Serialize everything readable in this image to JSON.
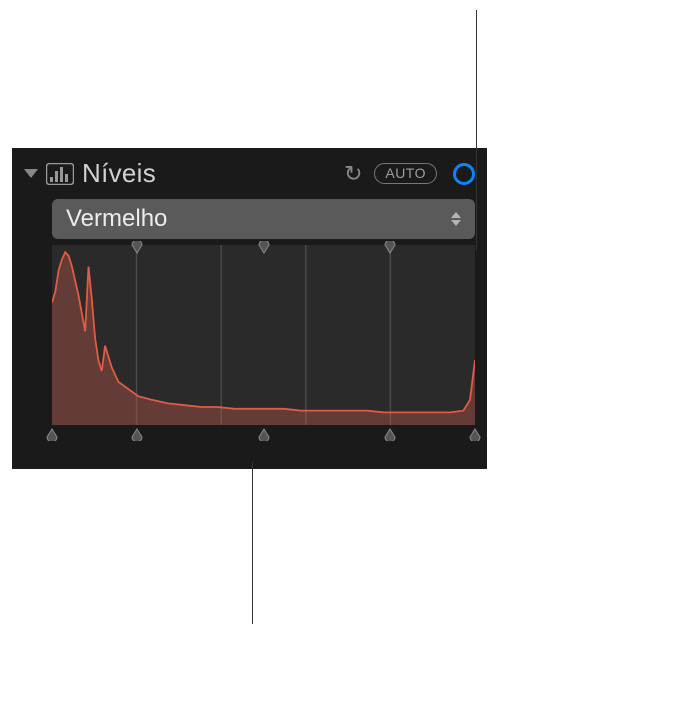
{
  "header": {
    "title": "Níveis",
    "auto_label": "AUTO"
  },
  "channel": {
    "selected": "Vermelho"
  },
  "chart_data": {
    "type": "area",
    "title": "",
    "xlabel": "",
    "ylabel": "",
    "xlim": [
      0,
      255
    ],
    "ylim": [
      0,
      100
    ],
    "grid_x": [
      20,
      40,
      60,
      80
    ],
    "handle_positions_pct": [
      0,
      20,
      50,
      80,
      100
    ],
    "series": [
      {
        "name": "Vermelho",
        "color": "#e25b44",
        "x": [
          0,
          2,
          4,
          6,
          8,
          10,
          12,
          14,
          16,
          18,
          20,
          22,
          24,
          26,
          28,
          30,
          32,
          36,
          40,
          46,
          52,
          60,
          70,
          80,
          90,
          100,
          110,
          120,
          130,
          140,
          150,
          160,
          170,
          180,
          190,
          200,
          210,
          220,
          230,
          240,
          248,
          252,
          255
        ],
        "values": [
          68,
          74,
          86,
          92,
          96,
          94,
          88,
          80,
          72,
          62,
          52,
          88,
          70,
          48,
          36,
          30,
          44,
          32,
          24,
          20,
          16,
          14,
          12,
          11,
          10,
          10,
          9,
          9,
          9,
          9,
          8,
          8,
          8,
          8,
          8,
          7,
          7,
          7,
          7,
          7,
          8,
          14,
          36
        ]
      }
    ]
  }
}
